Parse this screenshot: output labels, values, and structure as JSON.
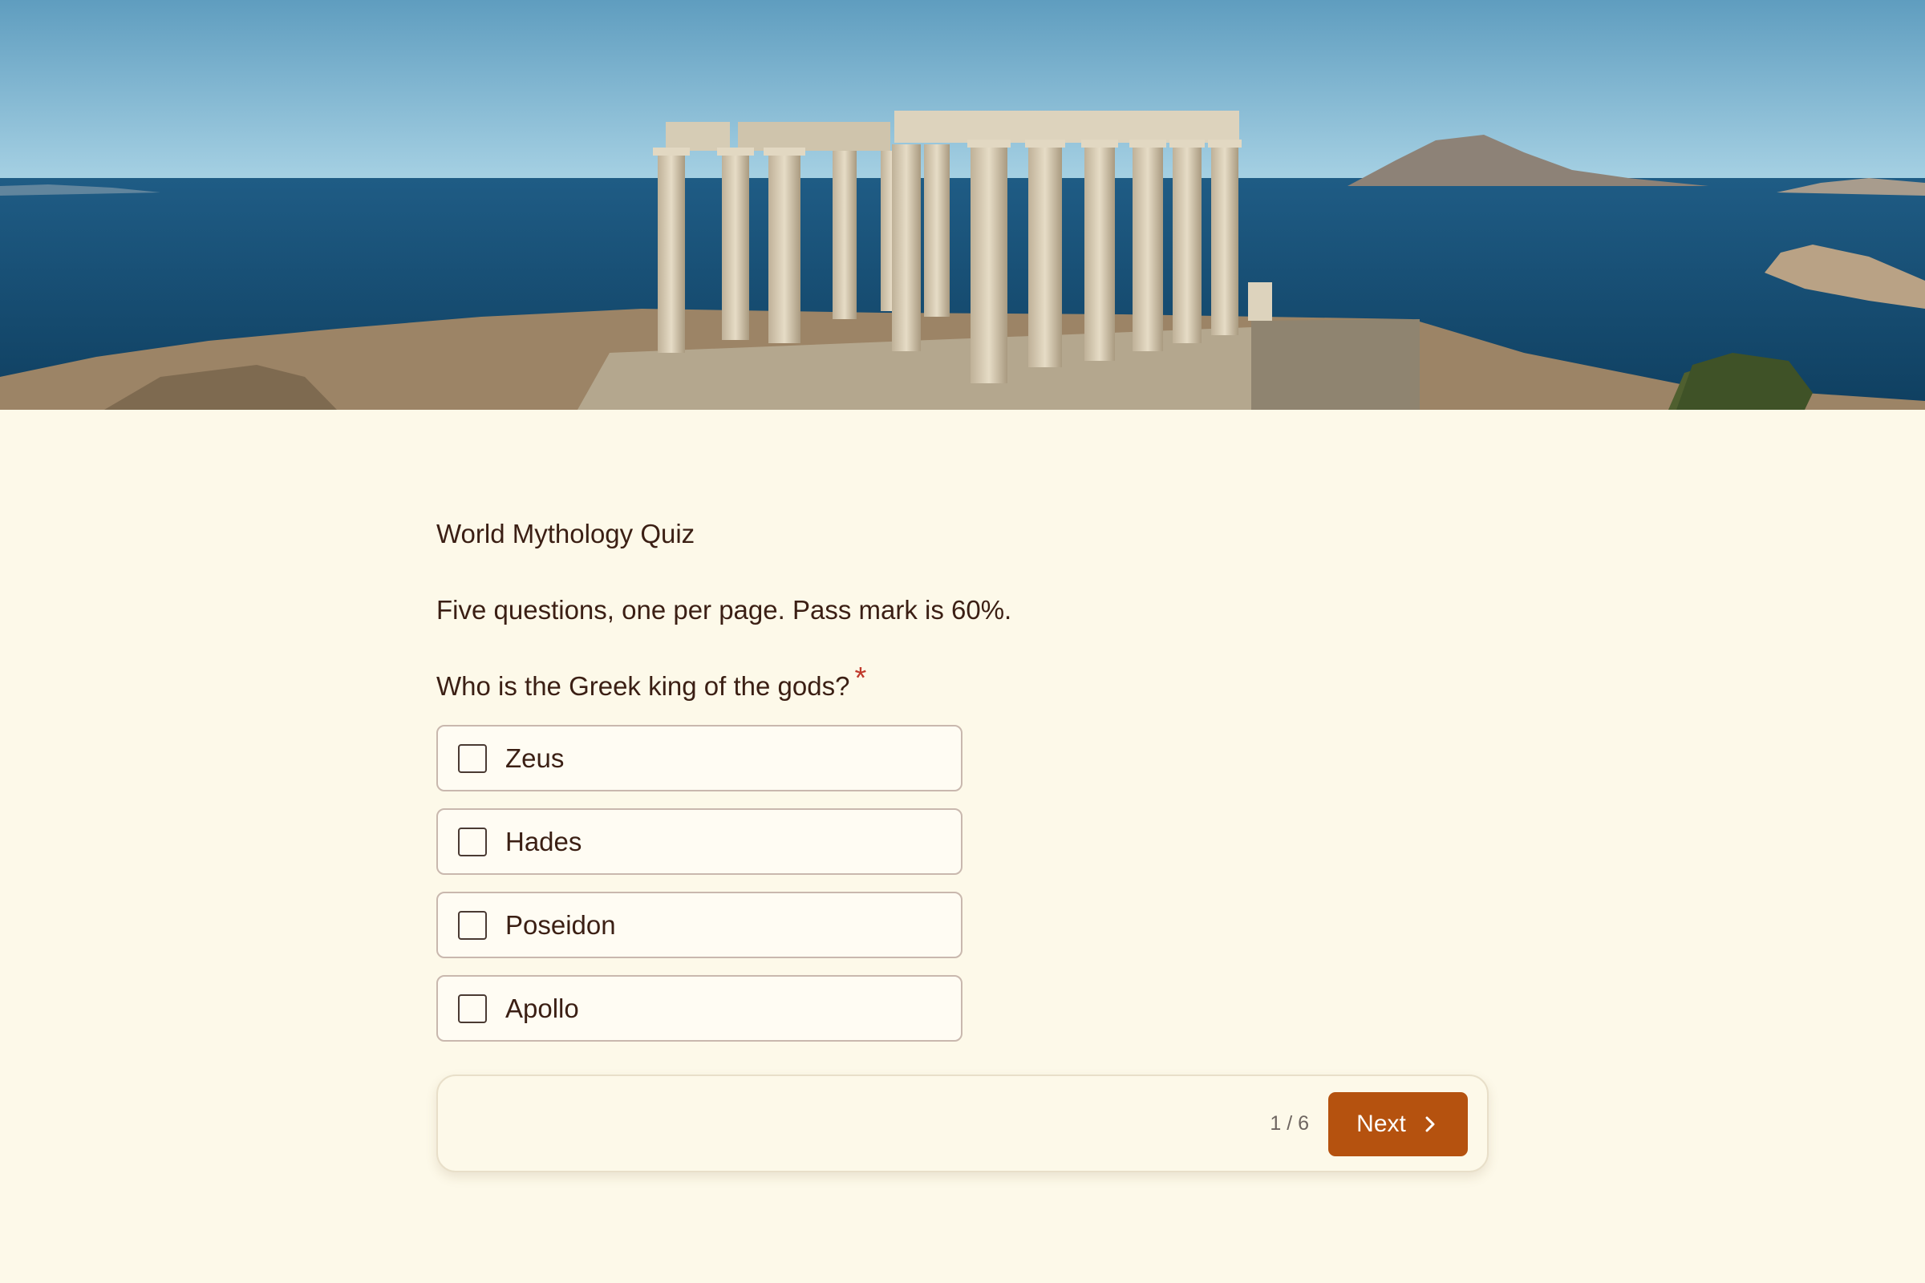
{
  "header_image": {
    "icon": "temple-landscape-photo",
    "colors": {
      "sky_top": "#6fa9c8",
      "sky_bottom": "#a8d2e4",
      "sea": "#134a6e",
      "stone": "#d8cdb6",
      "ground": "#9c8466"
    }
  },
  "quiz": {
    "title": "World Mythology Quiz",
    "description": "Five questions, one per page. Pass mark is 60%.",
    "question": "Who is the Greek king of the gods?",
    "required_marker": "*",
    "options": [
      {
        "label": "Zeus",
        "checked": false
      },
      {
        "label": "Hades",
        "checked": false
      },
      {
        "label": "Poseidon",
        "checked": false
      },
      {
        "label": "Apollo",
        "checked": false
      }
    ]
  },
  "navigation": {
    "page_indicator": "1 / 6",
    "next_label": "Next",
    "next_icon": "chevron-right-icon"
  },
  "colors": {
    "background": "#fdf9e9",
    "accent": "#b5520f",
    "text": "#3b1f14",
    "required": "#c0392b"
  }
}
